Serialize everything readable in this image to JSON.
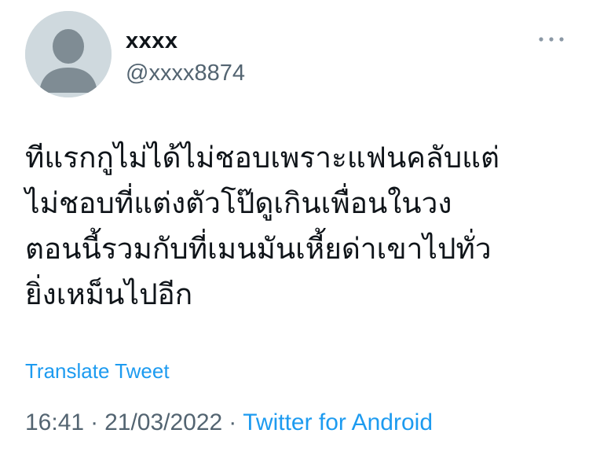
{
  "author": {
    "display_name": "xxxx",
    "handle": "@xxxx8874",
    "avatar_icon": "default-profile-avatar"
  },
  "menu": {
    "icon": "more-horizontal-icon"
  },
  "tweet": {
    "text_lines": [
      "ทีแรกกูไม่ได้ไม่ชอบเพราะแฟนคลับแต่",
      "ไม่ชอบที่แต่งตัวโป๊ดูเกินเพื่อนในวง",
      "ตอนนี้รวมกับที่เมนมันเหี้ยด่าเขาไปทั่ว",
      "ยิ่งเหม็นไปอีก"
    ],
    "translate_label": "Translate Tweet"
  },
  "meta": {
    "time": "16:41",
    "separator": "·",
    "date": "21/03/2022",
    "source": "Twitter for Android"
  },
  "colors": {
    "text_primary": "#0f1419",
    "text_secondary": "#536471",
    "link": "#1d9bf0",
    "avatar_bg": "#cfd9de",
    "avatar_figure": "#7f8c94"
  }
}
